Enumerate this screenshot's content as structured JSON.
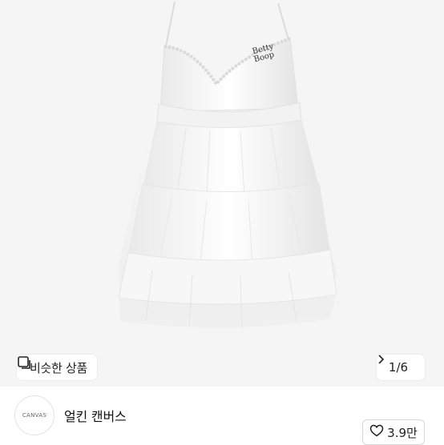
{
  "product": {
    "image_alt": "white tiered tulle slip dress",
    "embroidery_text": "Betty Boop"
  },
  "similar_button": {
    "label": "비슷한 상품",
    "icon": "similar-products-icon"
  },
  "image_counter": {
    "label": "1/6",
    "icon": "chevron-right-icon"
  },
  "shop": {
    "avatar_text": "CANVAS",
    "name": "얼킨 캔버스"
  },
  "like_button": {
    "label": "3.9만",
    "icon": "heart-outline-icon"
  }
}
